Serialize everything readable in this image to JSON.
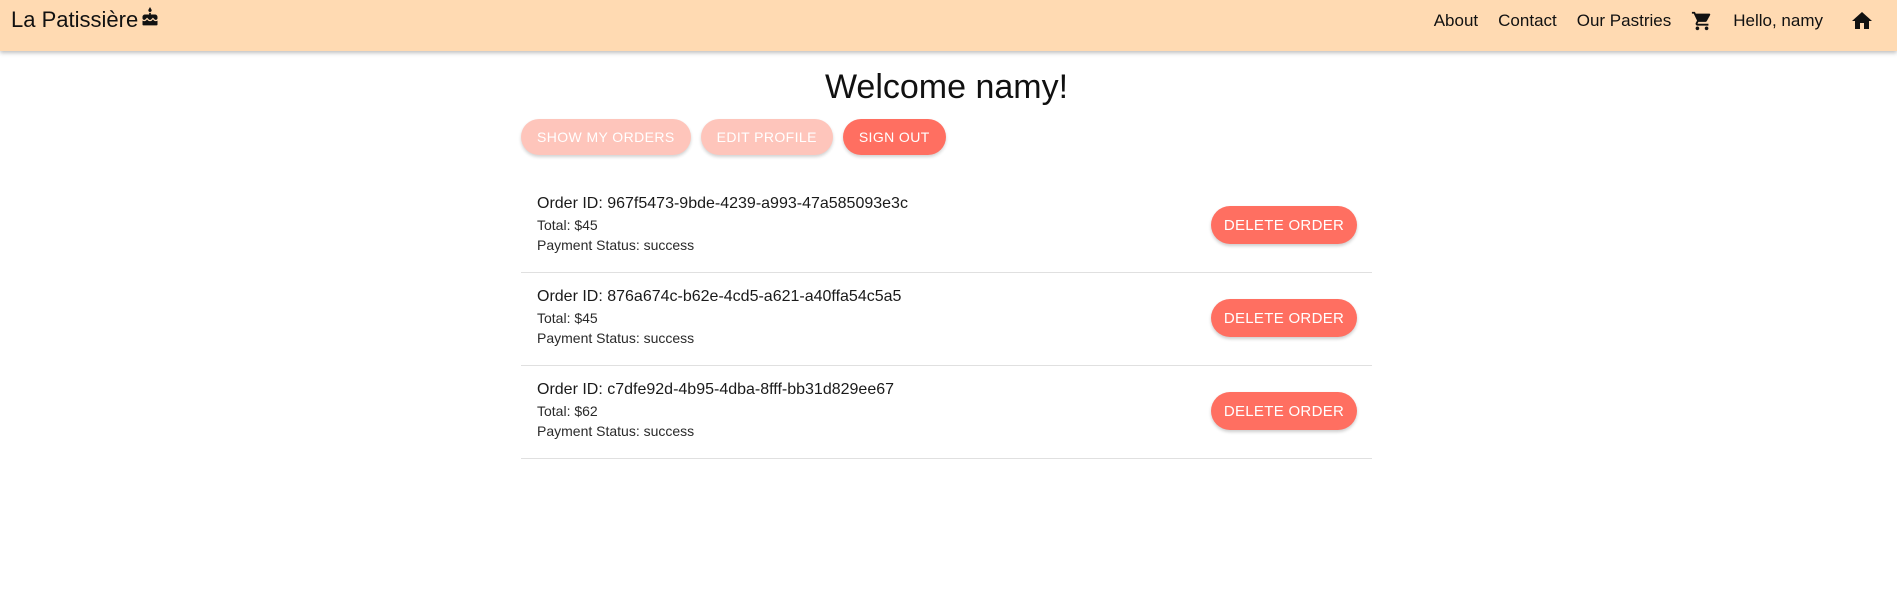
{
  "navbar": {
    "brand": "La Patissière",
    "brand_icon": "cake-icon",
    "links": [
      "About",
      "Contact",
      "Our Pastries"
    ],
    "cart_icon": "cart-icon",
    "greeting": "Hello, namy",
    "home_icon": "home-icon",
    "background": "#ffdab2"
  },
  "welcome": "Welcome namy!",
  "actions": {
    "show_orders": "SHOW MY ORDERS",
    "edit_profile": "EDIT PROFILE",
    "sign_out": "SIGN OUT"
  },
  "orders": [
    {
      "id": "Order ID: 967f5473-9bde-4239-a993-47a585093e3c",
      "total": "Total: $45",
      "status": "Payment Status: success",
      "delete_label": "DELETE ORDER"
    },
    {
      "id": "Order ID: 876a674c-b62e-4cd5-a621-a40ffa54c5a5",
      "total": "Total: $45",
      "status": "Payment Status: success",
      "delete_label": "DELETE ORDER"
    },
    {
      "id": "Order ID: c7dfe92d-4b95-4dba-8fff-bb31d829ee67",
      "total": "Total: $62",
      "status": "Payment Status: success",
      "delete_label": "DELETE ORDER"
    }
  ],
  "colors": {
    "accent": "#ff6f61",
    "accent_disabled": "#fec5bb"
  }
}
